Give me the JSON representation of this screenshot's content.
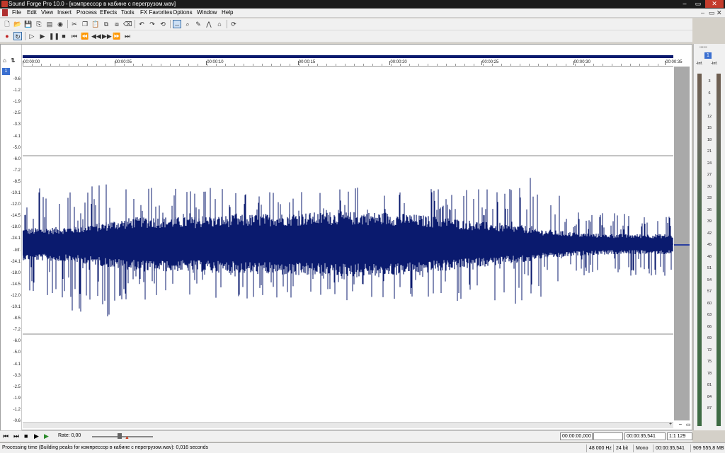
{
  "window": {
    "title": "Sound Forge Pro 10.0 - [компрессор в кабине с перегрузом.wav]",
    "min": "–",
    "max": "▭",
    "close": "✕"
  },
  "menu": [
    "File",
    "Edit",
    "View",
    "Insert",
    "Process",
    "Effects",
    "Tools",
    "FX Favorites",
    "Options",
    "Window",
    "Help"
  ],
  "mdi_controls": [
    "–",
    "▭",
    "✕"
  ],
  "toolbar1": [
    "new-icon",
    "open-icon",
    "save-icon",
    "save-as-icon",
    "render-icon",
    "properties-icon",
    "cut-icon",
    "copy-icon",
    "paste-icon",
    "paste-special-icon",
    "trim-icon",
    "delete-icon",
    "undo-icon",
    "redo-icon",
    "undo-all-icon",
    "edit-tool-icon",
    "magnify-tool-icon",
    "pencil-tool-icon",
    "envelope-tool-icon",
    "event-tool-icon",
    "ripple-icon"
  ],
  "toolbar2": [
    "record-icon",
    "loop-icon",
    "play-all-icon",
    "play-icon",
    "pause-icon",
    "stop-icon",
    "go-start-icon",
    "previous-marker-icon",
    "rewind-icon",
    "forward-icon",
    "next-marker-icon",
    "go-end-icon"
  ],
  "track": {
    "channel_number": "1",
    "db_labels": [
      "-0.6",
      "-1.2",
      "-1.9",
      "-2.5",
      "-3.3",
      "-4.1",
      "-5.0",
      "-6.0",
      "-7.2",
      "-8.5",
      "-10.1",
      "-12.0",
      "-14.5",
      "-18.0",
      "-24.1",
      "-Inf.",
      "-24.1",
      "-18.0",
      "-14.5",
      "-12.0",
      "-10.1",
      "-8.5",
      "-7.2",
      "-6.0",
      "-5.0",
      "-4.1",
      "-3.3",
      "-2.5",
      "-1.9",
      "-1.2",
      "-0.6"
    ],
    "time_labels": [
      "00:00:00",
      "00:00:05",
      "00:00:10",
      "00:00:15",
      "00:00:20",
      "00:00:25",
      "00:00:30",
      "00:00:35"
    ],
    "waveform_color": "#0a1a6e"
  },
  "meters": {
    "title": "▪▪▪▪▪▪",
    "badge": "1",
    "ch1_label": "-Inf.",
    "ch2_label": "-Inf.",
    "scale": [
      "3",
      "6",
      "9",
      "12",
      "15",
      "18",
      "21",
      "24",
      "27",
      "30",
      "33",
      "36",
      "39",
      "42",
      "45",
      "48",
      "51",
      "54",
      "57",
      "60",
      "63",
      "66",
      "69",
      "72",
      "75",
      "78",
      "81",
      "84",
      "87"
    ]
  },
  "transport": {
    "rate_label": "Rate: 0,00",
    "selection_start": "00:00:00,000",
    "selection_end": "",
    "selection_length": "00:00:35,541",
    "zoom_ratio": "1:1 129"
  },
  "status": {
    "message": "Processing time (Building peaks for компрессор в кабине с перегрузом.wav): 0,016 seconds",
    "sample_rate": "48 000 Hz",
    "bit_depth": "24 bit",
    "channels": "Mono",
    "length": "00:00:35,541",
    "disk_space": "909 555,8 MB"
  },
  "colors": {
    "waveform": "#0a1a6e",
    "title_bar": "#1b1b1b"
  }
}
